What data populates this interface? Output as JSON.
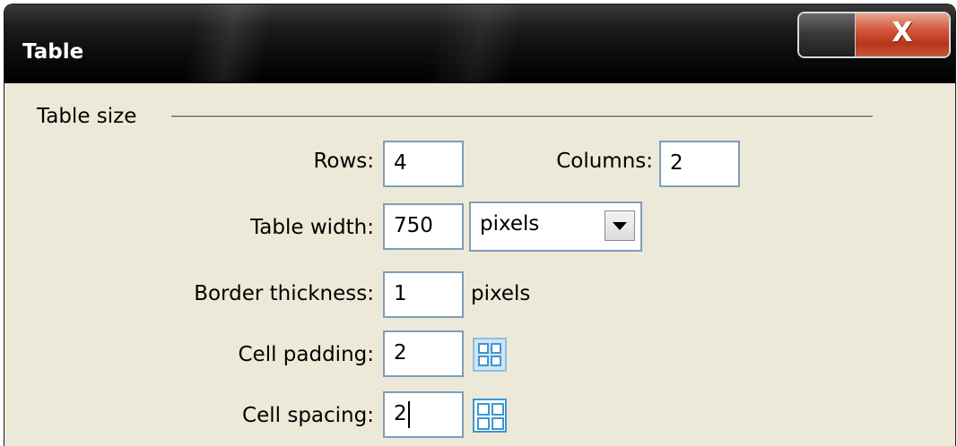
{
  "window": {
    "title": "Table",
    "close_glyph": "X"
  },
  "table_size": {
    "group_label": "Table size",
    "rows_label": "Rows:",
    "rows_value": "4",
    "columns_label": "Columns:",
    "columns_value": "2",
    "table_width_label": "Table width:",
    "table_width_value": "750",
    "width_unit_selected": "pixels",
    "border_thickness_label": "Border thickness:",
    "border_thickness_value": "1",
    "border_unit": "pixels",
    "cell_padding_label": "Cell padding:",
    "cell_padding_value": "2",
    "cell_spacing_label": "Cell spacing:",
    "cell_spacing_value": "2"
  },
  "icons": {
    "minimize": "minimize-icon",
    "close": "close-icon",
    "dropdown": "chevron-down-icon",
    "cell_padding": "cell-padding-icon",
    "cell_spacing": "cell-spacing-icon"
  },
  "colors": {
    "titlebar": "#000000",
    "close_button": "#c9472b",
    "dialog_background": "#ece9d8",
    "input_border": "#7f9db9",
    "icon_accent": "#3f95d2"
  }
}
